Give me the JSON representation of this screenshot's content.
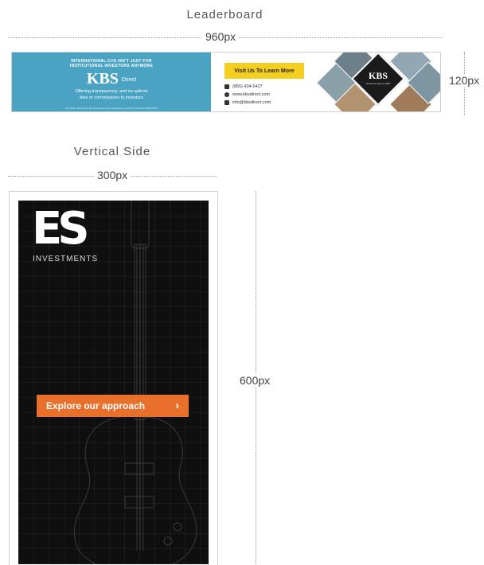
{
  "leaderboard": {
    "title": "Leaderboard",
    "width_label": "960px",
    "height_label": "120px",
    "ad": {
      "top_text_1": "INTERNATIONAL CVS ISN'T JUST FOR",
      "top_text_2": "INSTITUTIONAL INVESTORS ANYMORE",
      "logo": "KBS",
      "logo_sub": "Direct",
      "tagline_1": "Offering transparency, and no upfront",
      "tagline_2": "fees or commissions to investors",
      "fine_print": "Securities offered through Financial Industry Regulatory Authority, Member FINRA/SIPC",
      "cta": "Visit Us To Learn More",
      "phone": "(855) 434-5427",
      "website": "www.kbsdirect.com",
      "email": "info@kbsdirect.com",
      "right_logo": "KBS",
      "right_logo_sub": "Growth & Income REIT"
    }
  },
  "vertical": {
    "title": "Vertical Side",
    "width_label": "300px",
    "height_label": "600px",
    "ad": {
      "logo": "ES",
      "brand": "INVESTMENTS",
      "cta": "Explore our approach",
      "cta_icon": "chevron-right-icon"
    }
  },
  "colors": {
    "leader_blue": "#4ba3c3",
    "cta_yellow": "#f5cf1f",
    "cta_orange": "#e8702a"
  }
}
